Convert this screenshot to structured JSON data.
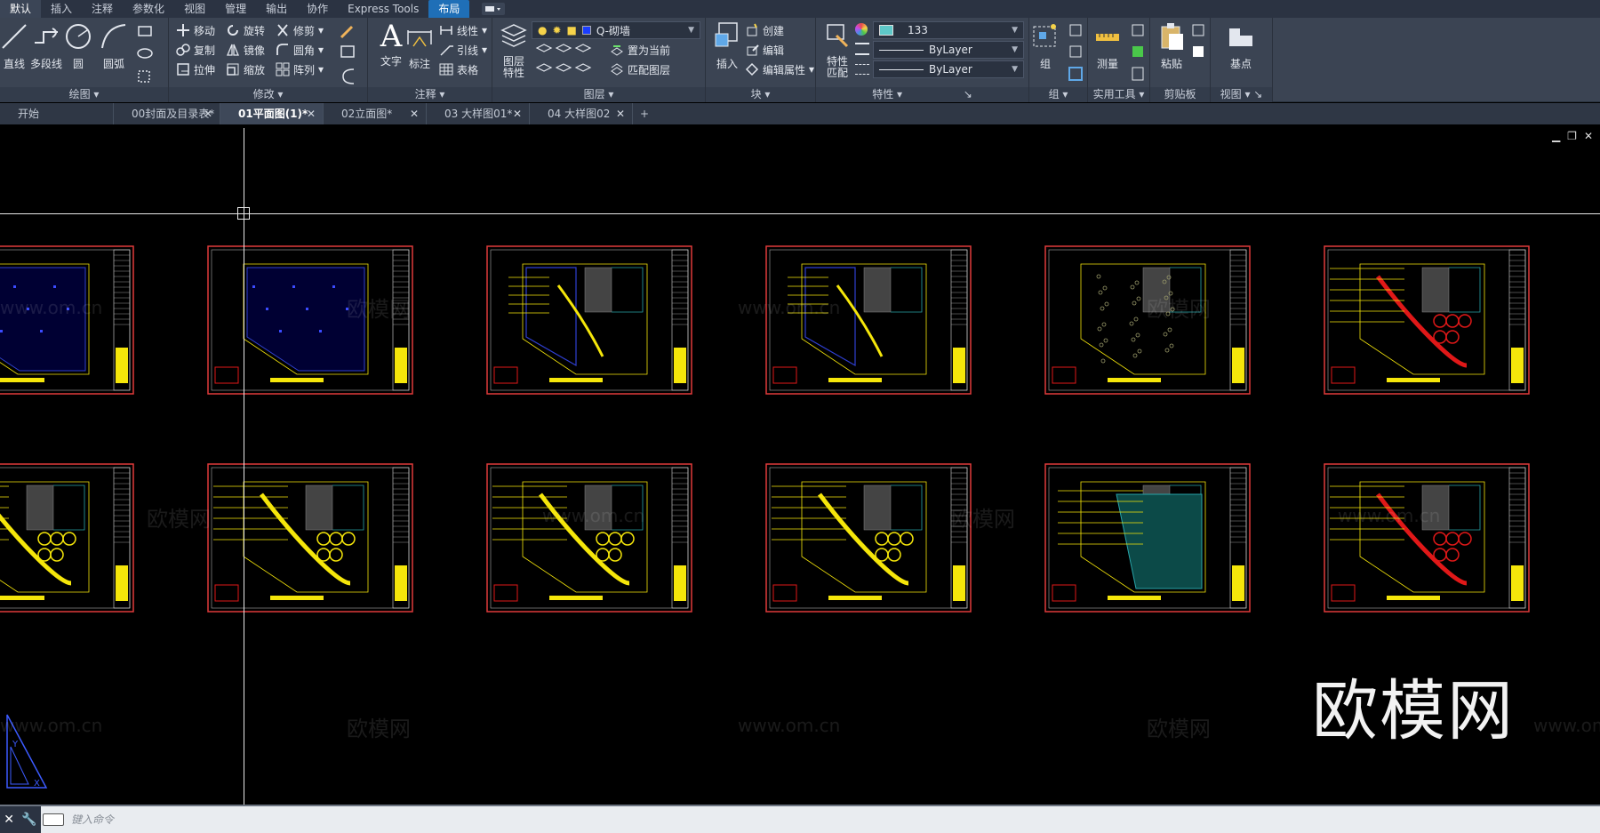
{
  "menu": {
    "tabs": [
      "默认",
      "插入",
      "注释",
      "参数化",
      "视图",
      "管理",
      "输出",
      "协作",
      "Express Tools",
      "布局"
    ]
  },
  "ribbon": {
    "draw": {
      "title": "绘图",
      "line": "直线",
      "polyline": "多段线",
      "circle": "圆",
      "arc": "圆弧"
    },
    "modify": {
      "title": "修改",
      "move": "移动",
      "rotate": "旋转",
      "trim": "修剪",
      "copy": "复制",
      "mirror": "镜像",
      "fillet": "圆角",
      "stretch": "拉伸",
      "scale": "缩放",
      "array": "阵列"
    },
    "annotation": {
      "title": "注释",
      "text": "文字",
      "dimension": "标注",
      "linear": "线性",
      "leader": "引线",
      "table": "表格"
    },
    "layers": {
      "title": "图层",
      "properties": "图层\n特性",
      "props_line1": "图层",
      "props_line2": "特性",
      "current_layer": "Q-砌墙",
      "set_current": "置为当前",
      "match_layer": "匹配图层"
    },
    "block": {
      "title": "块",
      "insert": "插入",
      "create": "创建",
      "edit": "编辑",
      "edit_attr": "编辑属性"
    },
    "properties": {
      "title": "特性",
      "match": "特性\n匹配",
      "match_line1": "特性",
      "match_line2": "匹配",
      "color": "133",
      "linetype": "ByLayer",
      "lineweight": "ByLayer"
    },
    "groups": {
      "title": "组",
      "group": "组"
    },
    "utilities": {
      "title": "实用工具",
      "measure": "测量"
    },
    "clipboard": {
      "title": "剪贴板",
      "paste": "粘贴"
    },
    "view": {
      "title": "视图",
      "base": "基点"
    }
  },
  "doc_tabs": [
    {
      "label": "开始",
      "closable": false
    },
    {
      "label": "00封面及目录表*",
      "closable": true
    },
    {
      "label": "01平面图(1)*",
      "closable": true,
      "active": true
    },
    {
      "label": "02立面图*",
      "closable": true
    },
    {
      "label": "03 大样图01*",
      "closable": true
    },
    {
      "label": "04 大样图02",
      "closable": true
    }
  ],
  "command_line": {
    "placeholder": "键入命令"
  },
  "watermark": {
    "main": "欧模网",
    "small_cn": "欧模网",
    "small_url": "www.om.cn"
  },
  "colors": {
    "ribbon_bg": "#3b4453",
    "menu_bg": "#2b3342",
    "active_tab": "#1f6fb7",
    "canvas": "#000000",
    "sheet_border": "#e03a3a",
    "drawing_yellow": "#f5e60a",
    "drawing_blue": "#2f3fd1",
    "drawing_cyan": "#28a4a8"
  },
  "sheets_count": 12
}
